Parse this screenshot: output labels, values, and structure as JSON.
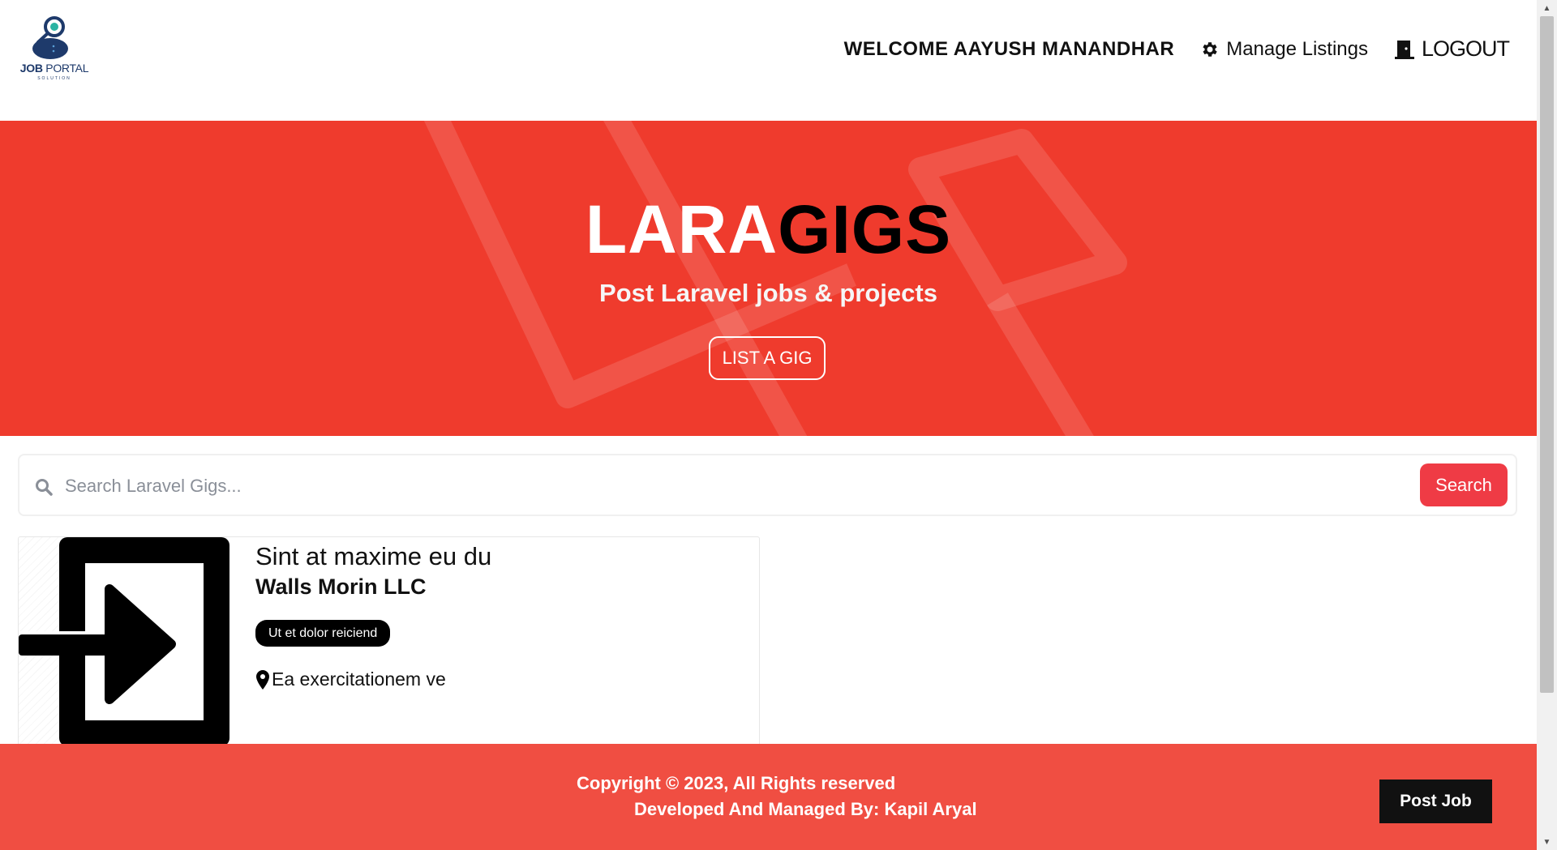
{
  "header": {
    "logo": {
      "primary": "JOB",
      "secondary": "PORTAL",
      "tagline": "SOLUTION"
    },
    "welcome": "WELCOME AAYUSH MANANDHAR",
    "manage_listings": "Manage Listings",
    "logout": "LOGOUT"
  },
  "hero": {
    "title_part1": "LARA",
    "title_part2": "GIGS",
    "subtitle": "Post Laravel jobs & projects",
    "button": "LIST A GIG"
  },
  "search": {
    "placeholder": "Search Laravel Gigs...",
    "value": "",
    "button": "Search"
  },
  "listings": [
    {
      "title": "Sint at maxime eu du",
      "company": "Walls Morin LLC",
      "tags": [
        "Ut et dolor reiciend"
      ],
      "location": "Ea exercitationem ve"
    }
  ],
  "footer": {
    "copyright": "Copyright © 2023, All Rights reserved",
    "developer": "Developed And Managed By: Kapil Aryal",
    "post_job": "Post Job"
  },
  "colors": {
    "hero_bg": "#ef3b2d",
    "footer_bg": "#f04e42",
    "search_button": "#ef3b45",
    "tag_bg": "#000000"
  },
  "icons": {
    "logo": "job-search-logo-icon",
    "manage": "gear-icon",
    "logout": "door-icon",
    "search": "search-icon",
    "listing_image": "login-arrow-icon",
    "location": "map-pin-icon"
  }
}
